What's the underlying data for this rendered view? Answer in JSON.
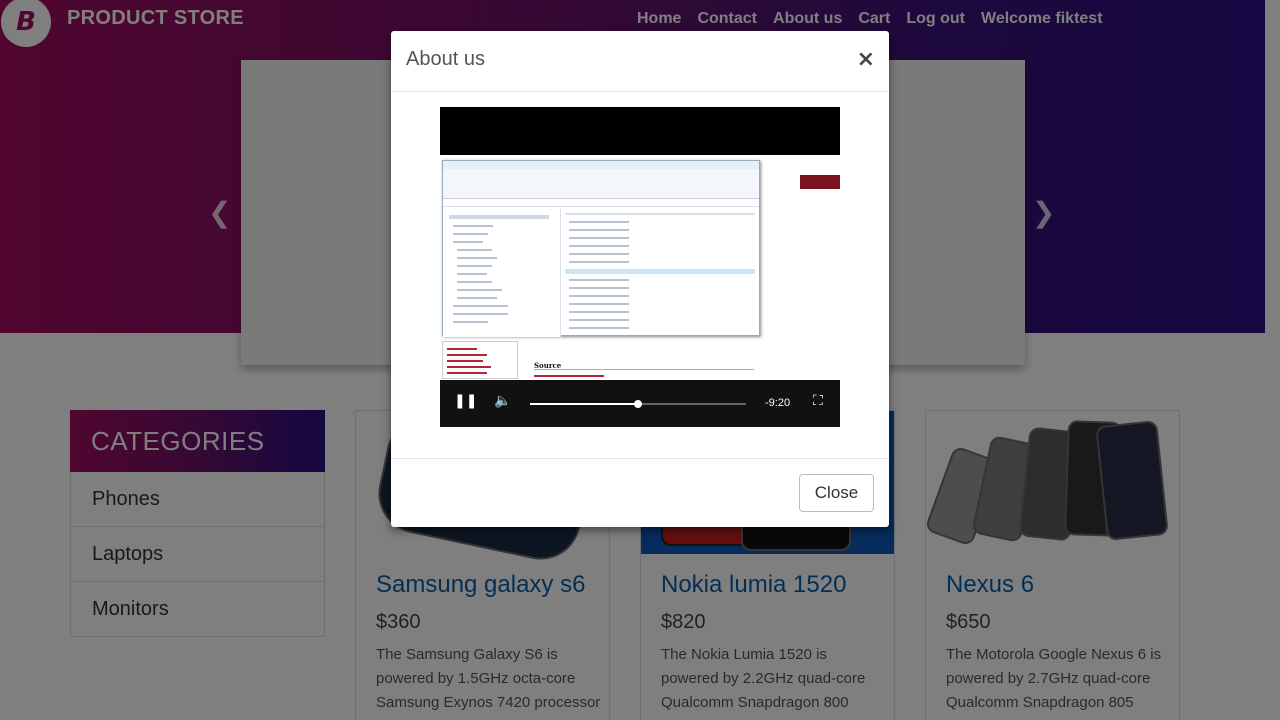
{
  "navbar": {
    "brand_logo_letter": "B",
    "brand_name": "PRODUCT STORE",
    "links": [
      "Home",
      "Contact",
      "About us",
      "Cart",
      "Log out",
      "Welcome fiktest"
    ]
  },
  "carousel": {
    "prev_icon": "chevron-left-icon",
    "next_icon": "chevron-right-icon"
  },
  "categories": {
    "header": "CATEGORIES",
    "items": [
      "Phones",
      "Laptops",
      "Monitors"
    ]
  },
  "products": [
    {
      "title": "Samsung galaxy s6",
      "price": "$360",
      "desc": "The Samsung Galaxy S6 is powered by 1.5GHz octa-core Samsung Exynos 7420 processor"
    },
    {
      "title": "Nokia lumia 1520",
      "price": "$820",
      "desc": "The Nokia Lumia 1520 is powered by 2.2GHz quad-core Qualcomm Snapdragon 800"
    },
    {
      "title": "Nexus 6",
      "price": "$650",
      "desc": "The Motorola Google Nexus 6 is powered by 2.7GHz quad-core Qualcomm Snapdragon 805"
    }
  ],
  "modal": {
    "title": "About us",
    "close_x": "×",
    "close_button": "Close",
    "video": {
      "time_remaining": "-9:20",
      "progress_fraction": 0.5,
      "source_heading": "Source",
      "controls": [
        "pause-icon",
        "volume-icon",
        "fullscreen-icon"
      ]
    }
  },
  "colors": {
    "brand_gradient_start": "#a10c5e",
    "brand_gradient_end": "#2a0e83",
    "link_blue": "#0b5fa5"
  }
}
